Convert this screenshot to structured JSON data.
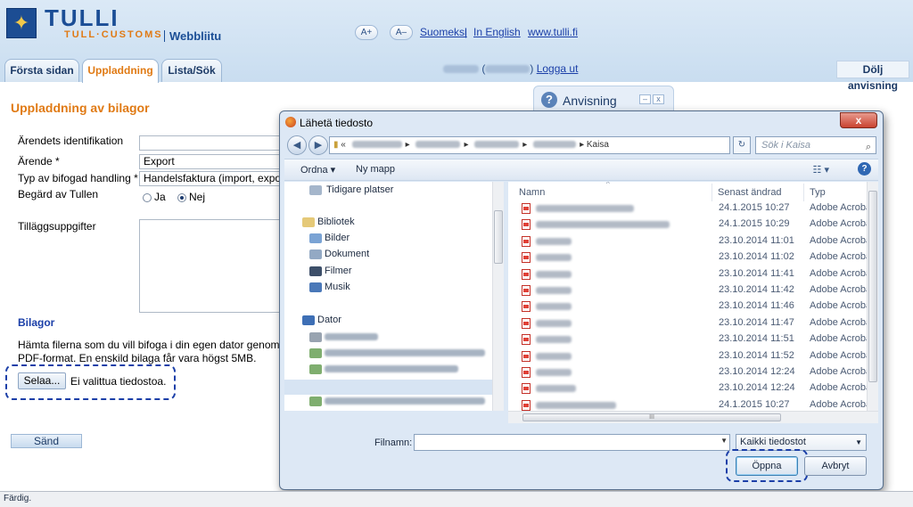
{
  "header": {
    "brand": "TULLI",
    "brand_sub": "TULL·CUSTOMS",
    "app_name": "Webbliitu",
    "font_increase": "A+",
    "font_decrease": "A–",
    "links": [
      "Suomeksi",
      "In English",
      "www.tulli.fi"
    ],
    "separator": "|"
  },
  "tabs": [
    {
      "label": "Första sidan",
      "active": false
    },
    {
      "label": "Uppladdning",
      "active": true
    },
    {
      "label": "Lista/Sök",
      "active": false
    }
  ],
  "user": {
    "logout": "Logga ut"
  },
  "hide_hint": "Dölj anvisning",
  "hint": {
    "title": "Anvisning"
  },
  "form": {
    "title": "Uppladdning av bilagor",
    "fields": [
      {
        "label": "Ärendets identifikation",
        "value": ""
      },
      {
        "label": "Ärende *",
        "value": "Export"
      },
      {
        "label": "Typ av bifogad handling *",
        "value": "Handelsfaktura (import, export"
      },
      {
        "label": "Begärd av Tullen",
        "value": ""
      }
    ],
    "radio_yes": "Ja",
    "radio_no": "Nej",
    "radio_selected": "Nej",
    "extra_label": "Tilläggsuppgifter",
    "attachments_title": "Bilagor",
    "attachments_text_1": "Hämta filerna som du vill bifoga i din egen dator genom att kl",
    "attachments_text_2": "PDF-format. En enskild bilaga får vara högst 5MB.",
    "browse_button": "Selaa...",
    "no_file": "Ei valittua tiedostoa.",
    "send_button": "Sänd"
  },
  "dialog": {
    "title": "Lähetä tiedosto",
    "close": "x",
    "address_prefix": "«",
    "address_last": "Kaisa",
    "search_placeholder": "Sök i Kaisa",
    "toolbar": {
      "organize": "Ordna ▾",
      "new_folder": "Ny mapp"
    },
    "nav": {
      "recent": "Tidigare platser",
      "libraries": "Bibliotek",
      "pictures": "Bilder",
      "documents": "Dokument",
      "movies": "Filmer",
      "music": "Musik",
      "computer": "Dator"
    },
    "columns": {
      "name": "Namn",
      "modified": "Senast ändrad",
      "type": "Typ"
    },
    "files": [
      {
        "date": "24.1.2015 10:27",
        "type": "Adobe Acroba"
      },
      {
        "date": "24.1.2015 10:29",
        "type": "Adobe Acroba"
      },
      {
        "date": "23.10.2014 11:01",
        "type": "Adobe Acroba"
      },
      {
        "date": "23.10.2014 11:02",
        "type": "Adobe Acroba"
      },
      {
        "date": "23.10.2014 11:41",
        "type": "Adobe Acroba"
      },
      {
        "date": "23.10.2014 11:42",
        "type": "Adobe Acroba"
      },
      {
        "date": "23.10.2014 11:46",
        "type": "Adobe Acroba"
      },
      {
        "date": "23.10.2014 11:47",
        "type": "Adobe Acroba"
      },
      {
        "date": "23.10.2014 11:51",
        "type": "Adobe Acroba"
      },
      {
        "date": "23.10.2014 11:52",
        "type": "Adobe Acroba"
      },
      {
        "date": "23.10.2014 12:24",
        "type": "Adobe Acroba"
      },
      {
        "date": "23.10.2014 12:24",
        "type": "Adobe Acroba"
      },
      {
        "date": "24.1.2015 10:27",
        "type": "Adobe Acroba"
      }
    ],
    "scroll_grip": "III",
    "filename_label": "Filnamn:",
    "filename_value": "",
    "filter": "Kaikki tiedostot",
    "open_button": "Öppna",
    "cancel_button": "Avbryt"
  },
  "status": "Färdig.",
  "colors": {
    "brand_blue": "#1b4e96",
    "brand_orange": "#e07a14",
    "highlight": "#1b3fa8"
  }
}
